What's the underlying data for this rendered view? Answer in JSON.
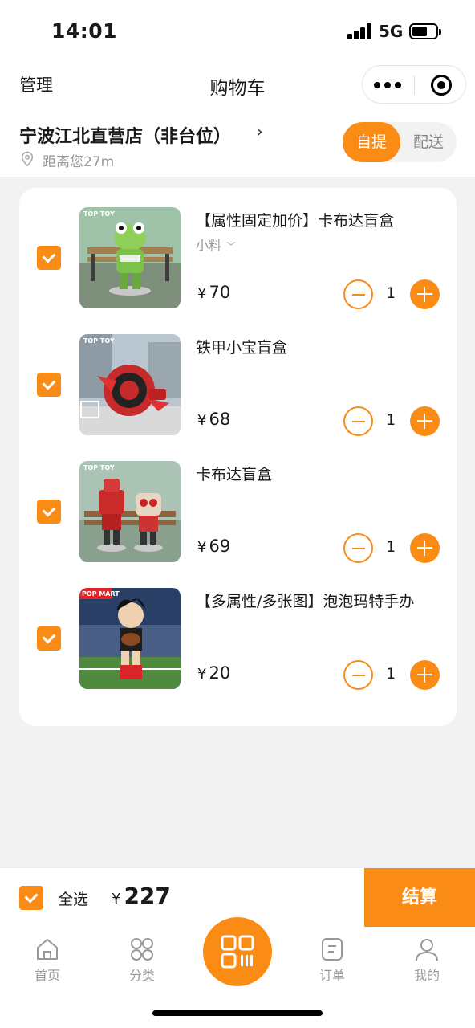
{
  "status_bar": {
    "time": "14:01",
    "network": "5G"
  },
  "header": {
    "manage_label": "管理",
    "title": "购物车"
  },
  "store": {
    "name": "宁波江北直营店（非台位）",
    "chevron": "›",
    "distance": "距离您27m",
    "modes": [
      "自提",
      "配送"
    ],
    "active_mode": "自提"
  },
  "cart": {
    "items": [
      {
        "name": "【属性固定加价】卡布达盲盒",
        "spec": "小料",
        "currency": "¥",
        "price": "70",
        "quantity": "1",
        "image_brand": "TOP TOY",
        "checked": true
      },
      {
        "name": "铁甲小宝盲盒",
        "spec": "",
        "currency": "¥",
        "price": "68",
        "quantity": "1",
        "image_brand": "TOP TOY",
        "checked": true
      },
      {
        "name": "卡布达盲盒",
        "spec": "",
        "currency": "¥",
        "price": "69",
        "quantity": "1",
        "image_brand": "TOP TOY",
        "checked": true
      },
      {
        "name": "【多属性/多张图】泡泡玛特手办",
        "spec": "",
        "currency": "¥",
        "price": "20",
        "quantity": "1",
        "image_brand": "POP MART",
        "checked": true
      }
    ]
  },
  "checkout": {
    "select_all_label": "全选",
    "currency": "¥",
    "total": "227",
    "button_label": "结算"
  },
  "tab_bar": {
    "tabs": [
      {
        "label": "首页",
        "icon": "home-icon"
      },
      {
        "label": "分类",
        "icon": "category-icon"
      },
      {
        "label": "",
        "icon": "scan-icon"
      },
      {
        "label": "订单",
        "icon": "order-icon"
      },
      {
        "label": "我的",
        "icon": "profile-icon"
      }
    ]
  },
  "colors": {
    "accent": "#fa8c16",
    "background": "#f2f2f2",
    "muted": "#999999"
  }
}
